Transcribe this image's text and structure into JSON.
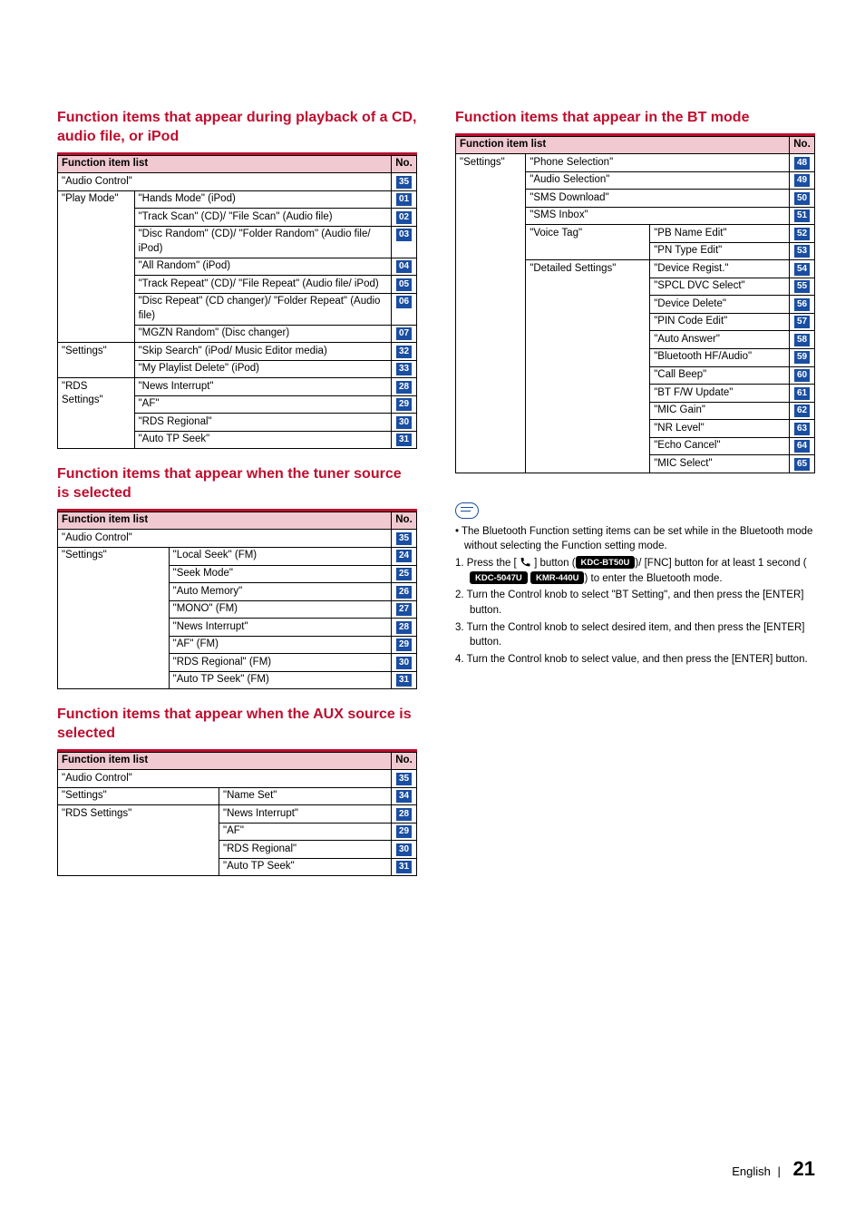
{
  "left": {
    "sec1": {
      "title": "Function items that appear during playback of a CD, audio file, or iPod",
      "header": {
        "list": "Function item list",
        "no": "No."
      },
      "rows": [
        {
          "a": "\"Audio Control\"",
          "span": 2,
          "no": "35"
        },
        {
          "a": "\"Play Mode\"",
          "b": "\"Hands Mode\" (iPod)",
          "no": "01"
        },
        {
          "b": "\"Track Scan\" (CD)/ \"File Scan\" (Audio file)",
          "no": "02"
        },
        {
          "b": "\"Disc Random\" (CD)/ \"Folder Random\" (Audio file/ iPod)",
          "no": "03"
        },
        {
          "b": "\"All Random\" (iPod)",
          "no": "04"
        },
        {
          "b": "\"Track Repeat\" (CD)/ \"File Repeat\" (Audio file/ iPod)",
          "no": "05"
        },
        {
          "b": "\"Disc Repeat\" (CD changer)/ \"Folder Repeat\" (Audio file)",
          "no": "06"
        },
        {
          "b": "\"MGZN Random\" (Disc changer)",
          "no": "07"
        },
        {
          "a": "\"Settings\"",
          "b": "\"Skip Search\" (iPod/ Music Editor media)",
          "no": "32"
        },
        {
          "b": "\"My Playlist Delete\" (iPod)",
          "no": "33"
        },
        {
          "a": "\"RDS Settings\"",
          "b": "\"News Interrupt\"",
          "no": "28"
        },
        {
          "b": "\"AF\"",
          "no": "29"
        },
        {
          "b": "\"RDS Regional\"",
          "no": "30"
        },
        {
          "b": "\"Auto TP Seek\"",
          "no": "31"
        }
      ]
    },
    "sec2": {
      "title": "Function items that appear when the tuner source is selected",
      "header": {
        "list": "Function item list",
        "no": "No."
      },
      "rows": [
        {
          "a": "\"Audio Control\"",
          "span": 2,
          "no": "35"
        },
        {
          "a": "\"Settings\"",
          "b": "\"Local Seek\" (FM)",
          "no": "24"
        },
        {
          "b": "\"Seek Mode\"",
          "no": "25"
        },
        {
          "b": "\"Auto Memory\"",
          "no": "26"
        },
        {
          "b": "\"MONO\" (FM)",
          "no": "27"
        },
        {
          "b": "\"News Interrupt\"",
          "no": "28"
        },
        {
          "b": "\"AF\" (FM)",
          "no": "29"
        },
        {
          "b": "\"RDS Regional\" (FM)",
          "no": "30"
        },
        {
          "b": "\"Auto TP Seek\" (FM)",
          "no": "31"
        }
      ]
    },
    "sec3": {
      "title": "Function items that appear when the AUX source is selected",
      "header": {
        "list": "Function item list",
        "no": "No."
      },
      "rows": [
        {
          "a": "\"Audio Control\"",
          "span": 2,
          "no": "35"
        },
        {
          "a": "\"Settings\"",
          "b": "\"Name Set\"",
          "no": "34"
        },
        {
          "a": "\"RDS Settings\"",
          "b": "\"News Interrupt\"",
          "no": "28"
        },
        {
          "b": "\"AF\"",
          "no": "29"
        },
        {
          "b": "\"RDS Regional\"",
          "no": "30"
        },
        {
          "b": "\"Auto TP Seek\"",
          "no": "31"
        }
      ]
    }
  },
  "right": {
    "sec1": {
      "title": "Function items that appear in the BT mode",
      "header": {
        "list": "Function item list",
        "no": "No."
      },
      "rows": [
        {
          "a": "\"Settings\"",
          "b": "\"Phone Selection\"",
          "bspan": 2,
          "no": "48"
        },
        {
          "b": "\"Audio Selection\"",
          "bspan": 2,
          "no": "49"
        },
        {
          "b": "\"SMS Download\"",
          "bspan": 2,
          "no": "50"
        },
        {
          "b": "\"SMS Inbox\"",
          "bspan": 2,
          "no": "51"
        },
        {
          "b": "\"Voice Tag\"",
          "c": "\"PB Name Edit\"",
          "no": "52"
        },
        {
          "c": "\"PN Type Edit\"",
          "no": "53"
        },
        {
          "b": "\"Detailed Settings\"",
          "c": "\"Device Regist.\"",
          "no": "54"
        },
        {
          "c": "\"SPCL DVC Select\"",
          "no": "55"
        },
        {
          "c": "\"Device Delete\"",
          "no": "56"
        },
        {
          "c": "\"PIN Code Edit\"",
          "no": "57"
        },
        {
          "c": "\"Auto Answer\"",
          "no": "58"
        },
        {
          "c": "\"Bluetooth HF/Audio\"",
          "no": "59"
        },
        {
          "c": "\"Call Beep\"",
          "no": "60"
        },
        {
          "c": "\"BT F/W Update\"",
          "no": "61"
        },
        {
          "c": "\"MIC Gain\"",
          "no": "62"
        },
        {
          "c": "\"NR Level\"",
          "no": "63"
        },
        {
          "c": "\"Echo Cancel\"",
          "no": "64"
        },
        {
          "c": "\"MIC Select\"",
          "no": "65"
        }
      ]
    },
    "note": {
      "bullet": "The Bluetooth Function setting items can be set while in the Bluetooth mode without selecting the Function setting mode.",
      "step1_a": "1. Press the [ ",
      "step1_b": " ] button (",
      "chip1": "KDC-BT50U",
      "step1_c": ")/ [FNC] button for at least 1 second (",
      "chip2": "KDC-5047U",
      "chip3": "KMR-440U",
      "step1_d": ") to enter the Bluetooth mode.",
      "step2": "2. Turn the Control knob to select \"BT Setting\", and then press the [ENTER] button.",
      "step3": "3. Turn the Control knob to select desired item, and then press the [ENTER] button.",
      "step4": "4. Turn the Control knob to select value, and then press the [ENTER] button."
    }
  },
  "footer": {
    "lang": "English",
    "sep": "|",
    "page": "21"
  }
}
